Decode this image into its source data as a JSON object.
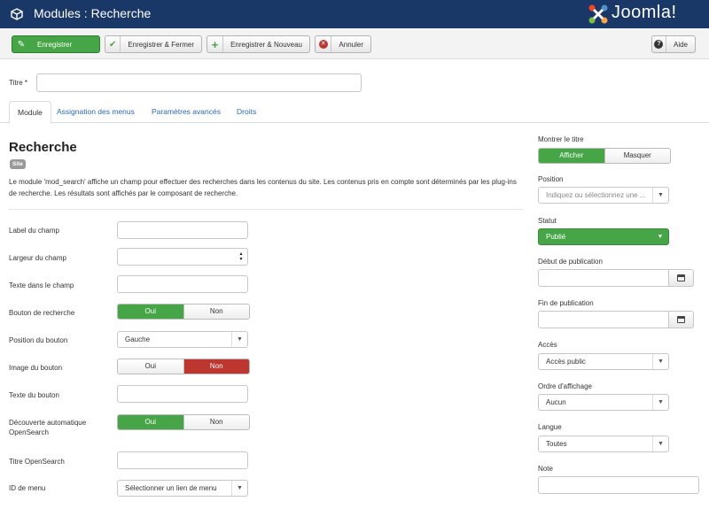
{
  "header": {
    "title": "Modules : Recherche",
    "logo_text": "Joomla!"
  },
  "toolbar": {
    "save": "Enregistrer",
    "save_close": "Enregistrer & Fermer",
    "save_new": "Enregistrer & Nouveau",
    "cancel": "Annuler",
    "help": "Aide"
  },
  "title_field": {
    "label": "Titre *",
    "value": ""
  },
  "tabs": [
    "Module",
    "Assignation des menus",
    "Paramètres avancés",
    "Droits"
  ],
  "module": {
    "heading": "Recherche",
    "badge": "Site",
    "description": "Le module 'mod_search' affiche un champ pour effectuer des recherches dans les contenus du site. Les contenus pris en compte sont déterminés par les plug-ins de recherche. Les résultats sont affichés par le composant de recherche."
  },
  "fields": {
    "label_champ": "Label du champ",
    "largeur_champ": "Largeur du champ",
    "texte_champ": "Texte dans le champ",
    "bouton_recherche": "Bouton de recherche",
    "position_bouton": "Position du bouton",
    "position_bouton_value": "Gauche",
    "image_bouton": "Image du bouton",
    "texte_bouton": "Texte du bouton",
    "opensearch_auto": "Découverte automatique OpenSearch",
    "titre_opensearch": "Titre OpenSearch",
    "id_menu": "ID de menu",
    "id_menu_value": "Sélectionner un lien de menu",
    "oui": "Oui",
    "non": "Non"
  },
  "sidebar": {
    "show_title": "Montrer le titre",
    "afficher": "Afficher",
    "masquer": "Masquer",
    "position": "Position",
    "position_placeholder": "Indiquez ou sélectionnez une ...",
    "statut": "Statut",
    "statut_value": "Publié",
    "debut": "Début de publication",
    "fin": "Fin de publication",
    "acces": "Accès",
    "acces_value": "Accès public",
    "ordre": "Ordre d'affichage",
    "ordre_value": "Aucun",
    "langue": "Langue",
    "langue_value": "Toutes",
    "note": "Note"
  },
  "colors": {
    "header_bg": "#1a3867",
    "green": "#46a546",
    "red": "#bd362f",
    "link": "#2a69b8"
  }
}
